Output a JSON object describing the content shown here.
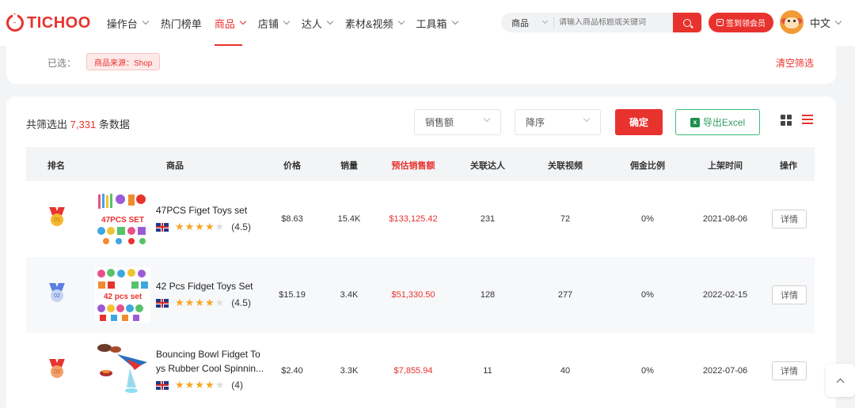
{
  "header": {
    "logo_text": "TICHOO",
    "nav": [
      {
        "label": "操作台",
        "has_dropdown": true,
        "active": false
      },
      {
        "label": "热门榜单",
        "has_dropdown": false,
        "active": false
      },
      {
        "label": "商品",
        "has_dropdown": true,
        "active": true
      },
      {
        "label": "店铺",
        "has_dropdown": true,
        "active": false
      },
      {
        "label": "达人",
        "has_dropdown": true,
        "active": false
      },
      {
        "label": "素材&视频",
        "has_dropdown": true,
        "active": false
      },
      {
        "label": "工具箱",
        "has_dropdown": true,
        "active": false
      }
    ],
    "search": {
      "category": "商品",
      "placeholder": "请输入商品标题或关键词"
    },
    "signin_label": "签到领会员",
    "language": "中文",
    "accent_color": "#e8322e"
  },
  "filter": {
    "selected_label": "已选：",
    "chips": [
      "商品来源：Shop"
    ],
    "clear_label": "清空筛选"
  },
  "toolbar": {
    "total_prefix": "共筛选出",
    "total_count": "7,331",
    "total_suffix": "条数据",
    "sort_field": "销售额",
    "sort_order": "降序",
    "confirm_label": "确定",
    "export_label": "导出Excel",
    "export_icon": "excel-icon"
  },
  "table": {
    "columns": [
      "排名",
      "商品",
      "价格",
      "销量",
      "预估销售额",
      "关联达人",
      "关联视频",
      "佣金比例",
      "上架时间",
      "操作"
    ],
    "highlight_column": "预估销售额",
    "rows": [
      {
        "rank": "01",
        "name_line1": "47PCS Figet Toys set",
        "name_line2": "",
        "rating": "(4.5)",
        "stars": 4.5,
        "price": "$8.63",
        "sales": "15.4K",
        "revenue": "$133,125.42",
        "creators": "231",
        "videos": "72",
        "commission": "0%",
        "date": "2021-08-06",
        "action": "详情"
      },
      {
        "rank": "02",
        "name_line1": "42 Pcs Fidget Toys Set",
        "name_line2": "",
        "rating": "(4.5)",
        "stars": 4.5,
        "price": "$15.19",
        "sales": "3.4K",
        "revenue": "$51,330.50",
        "creators": "128",
        "videos": "277",
        "commission": "0%",
        "date": "2022-02-15",
        "action": "详情"
      },
      {
        "rank": "03",
        "name_line1": "Bouncing Bowl Fidget To",
        "name_line2": "ys Rubber Cool Spinnin...",
        "rating": "(4)",
        "stars": 4,
        "price": "$2.40",
        "sales": "3.3K",
        "revenue": "$7,855.94",
        "creators": "11",
        "videos": "40",
        "commission": "0%",
        "date": "2022-07-06",
        "action": "详情"
      }
    ]
  },
  "thumbnails": {
    "row1_caption": "47PCS SET",
    "row2_caption": "42 pcs set"
  }
}
